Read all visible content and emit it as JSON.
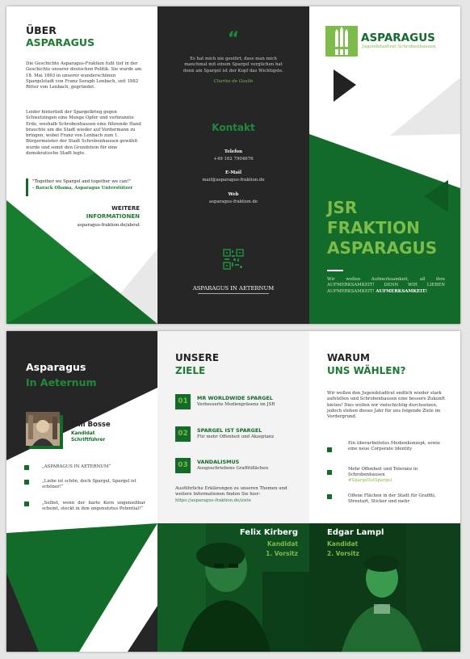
{
  "colors": {
    "green": "#136b2a",
    "dark": "#262626",
    "light_green": "#8bc34a",
    "grey": "#e8e8e8"
  },
  "page1": {
    "left": {
      "title1": "ÜBER",
      "title2": "ASPARAGUS",
      "para1": "Die Geschichte Asparagus-Fraktion fußt tief in der Geschichte unserer deutschen Politik. Sie wurde am 18. Mai 1863 in unserer wunderschönen Spargelstadt von Franz Seraph Lenbach, seit 1882 Ritter von Lenbach, gegründet.",
      "para2": "Leider hinterließ der Spargelkrieg gegen Schwetzingen eine Menge Opfer und verbrannte Erde, weshalb Schrobenhausen eine führende Hand brauchte um die Stadt wieder auf Vordermann zu bringen, wobei Franz von Lenbach zum 1. Bürgermeister der Stadt Schrobenhausen gewählt wurde und somit den Grundstein für eine demokratische Stadt legte.",
      "quote": "\"Together we Spargel and together we can!\"",
      "quote_author": "- Barack Obama, Asparagus Unterstützer",
      "more1": "WEITERE",
      "more2": "INFORMATIONEN",
      "more_link": "asparagus-fraktion.de/about"
    },
    "middle": {
      "quote_mark": "“",
      "quote": "Es hat mich nie gestört, dass man mich manchmal mit einem Spargel verglichen hat denn am Spargel ist der Kopf das Wichtigste.",
      "quote_author": "Charles de Gaulle",
      "contact_title": "Kontakt",
      "phone_label": "Telefon",
      "phone": "+49 162 7904676",
      "email_label": "E-Mail",
      "email": "mail@asparagus-fraktion.de",
      "web_label": "Web",
      "web": "asparagus-fraktion.de",
      "footer": "ASPARAGUS IN AETERNUM"
    },
    "right": {
      "logo_name": "ASPARAGUS",
      "logo_sub": "Jugendstadtrat Schrobenhausen",
      "title1": "JSR",
      "title2": "FRAKTION",
      "title3": "ASPARAGUS",
      "text": "Wir wollen Aufmerksamkeit, all ihre AUFMERKSAMKEIT! DENN WIR LIEBEN AUFMERKSAMKEIT!",
      "text_bold": "AUFMERKSAMKEIT!"
    }
  },
  "page2": {
    "left": {
      "title1": "Asparagus",
      "title2": "In Aeternum",
      "name": "Tim Bosse",
      "role1": "Kandidat",
      "role2": "Schriftführer",
      "quotes": [
        "„ASPARAGUS IN AETERNUM“",
        "„Liebe ist schön, doch Spargel, Spargel ist schöner!“",
        "„Selbst, wenn der harte Kern ungenießbar scheint, steckt in ihm ungenutztes Potential!“"
      ]
    },
    "middle": {
      "title1": "UNSERE",
      "title2": "ZIELE",
      "goals": [
        {
          "num": "01",
          "title": "MR WORLDWIDE SPARGEL",
          "desc": "Verbesserte Medienpräsenz im JSR"
        },
        {
          "num": "02",
          "title": "SPARGEL IST SPARGEL",
          "desc": "Für mehr Offenheit und Akzeptanz"
        },
        {
          "num": "03",
          "title": "VANDALISMUS",
          "desc": "Ausgeschriebene Graffitiflächen"
        }
      ],
      "more": "Ausführliche Erklärungen zu unseren Themen und weitere Informationen finden Sie hier:",
      "more_link": "https://asparagus-fraktion.de/ziele",
      "cand_name": "Felix Kirberg",
      "cand_role1": "Kandidat",
      "cand_role2": "1. Vorsitz"
    },
    "right": {
      "title1": "WARUM",
      "title2": "UNS WÄHLEN?",
      "intro": "Wir wollen den Jugendstadtrat endlich wieder stark aufstellen und Schrobenhausen eine bessere Zukunft bieten! Dies wollen wir vielschichtig durchsetzen, jedoch stehen dieses Jahr für uns folgende Ziele im Vordergrund.",
      "bullets": [
        "Ein überarbeitetes Medienkonzept, sowie eine neue Corporate Identity",
        "Mehr Offenheit und Toleranz in Schrobenhausen",
        "Offene Flächen in der Stadt für Graffiti, Streetart, Sticker und mehr"
      ],
      "hashtag": "#SpargelIstSpargel",
      "cand_name": "Edgar Lampl",
      "cand_role1": "Kandidat",
      "cand_role2": "2. Vorsitz"
    }
  }
}
